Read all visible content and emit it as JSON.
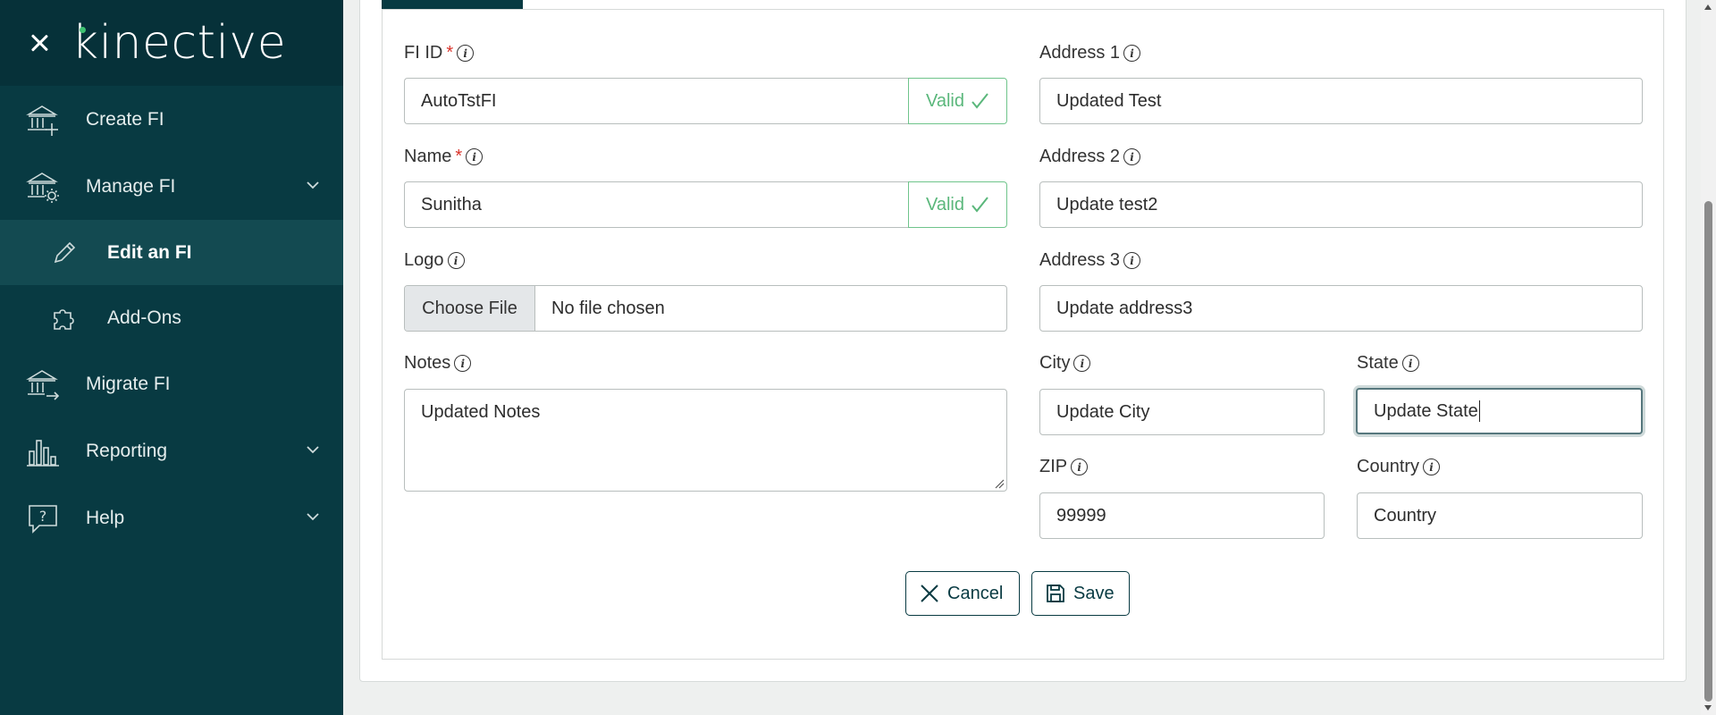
{
  "brand": {
    "logo_text": "kinective"
  },
  "sidebar": {
    "items": [
      {
        "label": "Create FI"
      },
      {
        "label": "Manage FI"
      },
      {
        "label": "Edit an FI"
      },
      {
        "label": "Add-Ons"
      },
      {
        "label": "Migrate FI"
      },
      {
        "label": "Reporting"
      },
      {
        "label": "Help"
      }
    ]
  },
  "form": {
    "fi_id": {
      "label": "FI ID",
      "required_mark": "*",
      "value": "AutoTstFI",
      "status": "Valid"
    },
    "name": {
      "label": "Name",
      "required_mark": "*",
      "value": "Sunitha",
      "status": "Valid"
    },
    "logo": {
      "label": "Logo",
      "button": "Choose File",
      "file_text": "No file chosen"
    },
    "notes": {
      "label": "Notes",
      "value": "Updated Notes"
    },
    "address1": {
      "label": "Address 1",
      "value": "Updated Test"
    },
    "address2": {
      "label": "Address 2",
      "value": "Update test2"
    },
    "address3": {
      "label": "Address 3",
      "value": "Update address3"
    },
    "city": {
      "label": "City",
      "value": "Update City"
    },
    "state": {
      "label": "State",
      "value": "Update State"
    },
    "zip": {
      "label": "ZIP",
      "value": "99999"
    },
    "country": {
      "label": "Country",
      "value": "",
      "placeholder": "Country"
    },
    "info_glyph": "i",
    "cancel_label": "Cancel",
    "save_label": "Save"
  },
  "colors": {
    "sidebar_bg": "#083a42",
    "sidebar_active": "#134a51",
    "brand_accent": "#3ec372",
    "valid_green": "#5ab77b",
    "required_red": "#d9342b"
  }
}
